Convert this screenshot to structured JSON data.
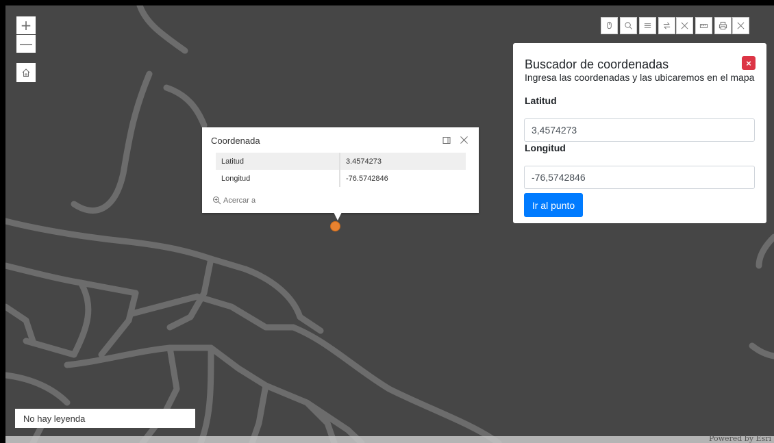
{
  "map": {
    "zoom_in_label": "+",
    "zoom_out_label": "—",
    "attribution": "Powered by Esri",
    "marker_color": "#e8822f",
    "road_color": "#6c6c6c",
    "background_color": "#464646"
  },
  "toolbar": {
    "tools": [
      "mouse-icon",
      "search-icon",
      "list-icon",
      "swap-icon",
      "close-icon",
      "ruler-icon",
      "print-icon",
      "close-icon"
    ]
  },
  "popup": {
    "title": "Coordenada",
    "rows": [
      {
        "label": "Latitud",
        "value": "3.4574273"
      },
      {
        "label": "Longitud",
        "value": "-76.5742846"
      }
    ],
    "zoom_action": "Acercar a"
  },
  "panel": {
    "title": "Buscador de coordenadas",
    "subtitle": "Ingresa las coordenadas y las ubicaremos en el mapa",
    "latitude_label": "Latitud",
    "latitude_value": "3,4574273",
    "longitude_label": "Longitud",
    "longitude_value": "-76,5742846",
    "submit_label": "Ir al punto",
    "close_symbol": "×",
    "accent_color": "#007bff",
    "close_color": "#dc3545"
  },
  "legend": {
    "text": "No hay leyenda"
  }
}
